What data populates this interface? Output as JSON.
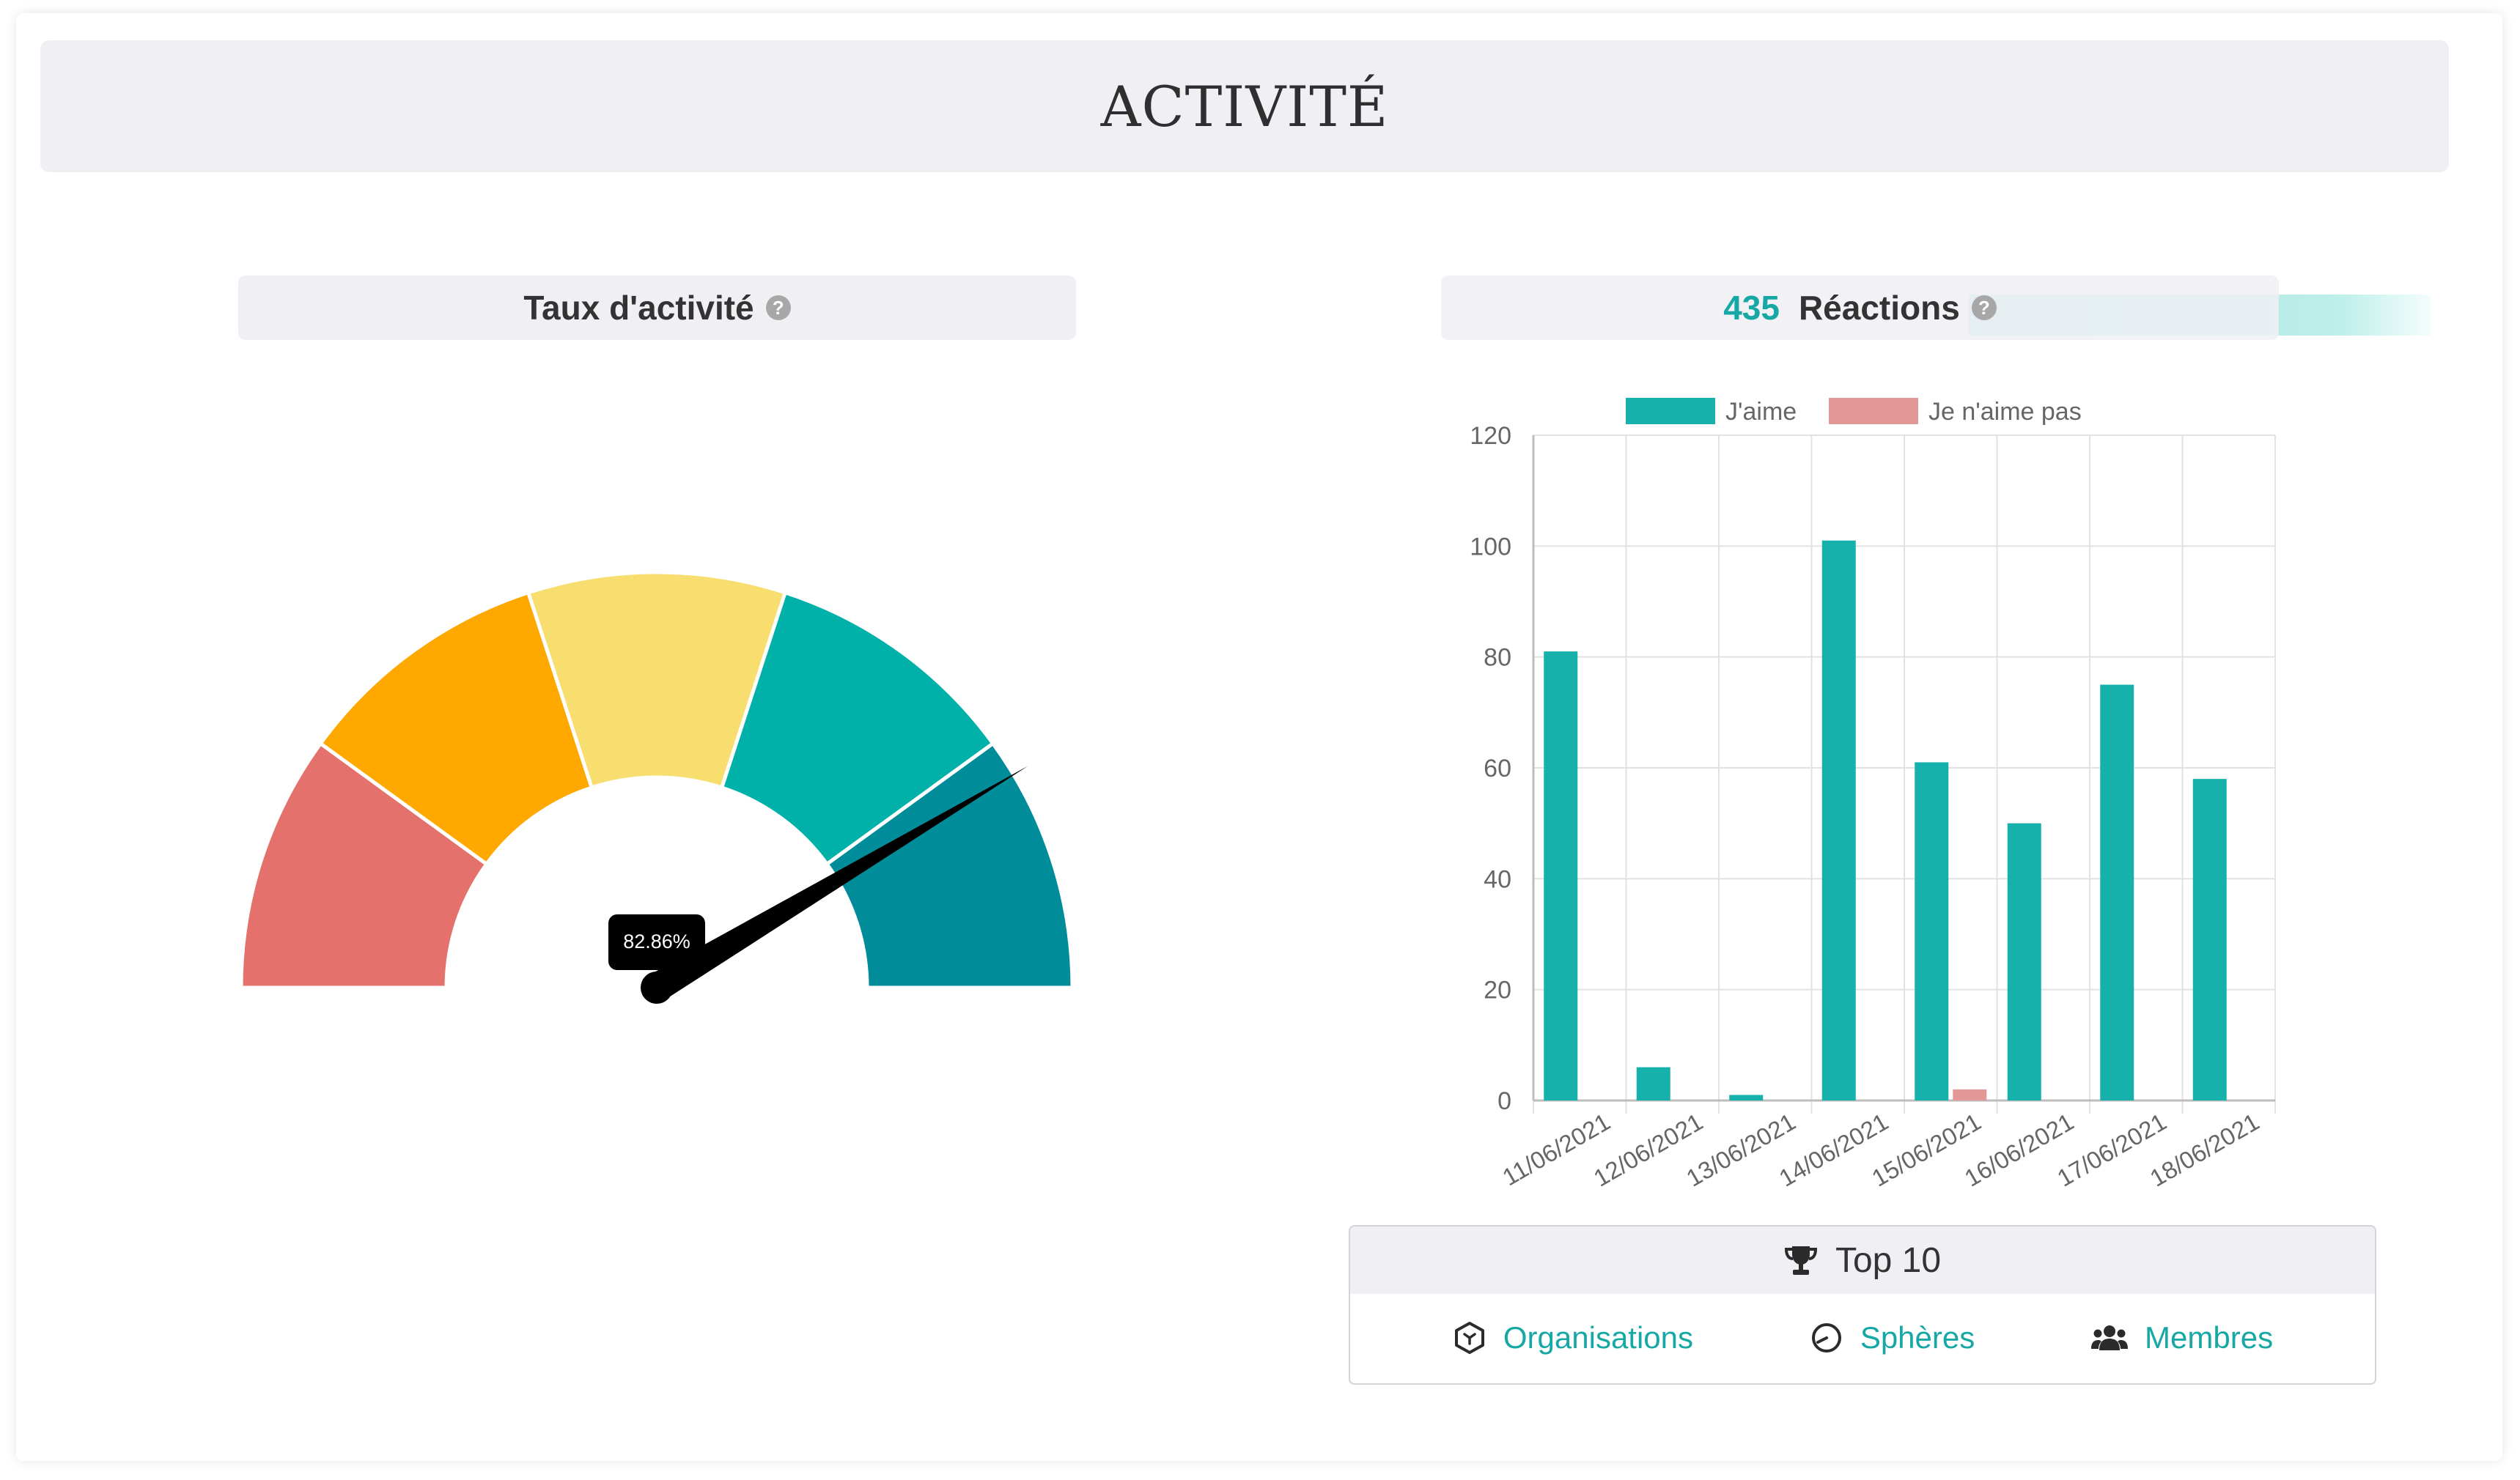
{
  "page": {
    "title": "ACTIVITÉ"
  },
  "activity_rate": {
    "title": "Taux d'activité",
    "help_icon": "question-circle-icon",
    "value": 82.86,
    "value_label": "82.86%",
    "zones": [
      {
        "color": "#e4716b"
      },
      {
        "color": "#fea800"
      },
      {
        "color": "#f8de6e"
      },
      {
        "color": "#00b1a9"
      },
      {
        "color": "#008d99"
      }
    ]
  },
  "reactions": {
    "count": "435",
    "title": "Réactions",
    "help_icon": "question-circle-icon"
  },
  "chart_data": {
    "type": "bar",
    "categories": [
      "11/06/2021",
      "12/06/2021",
      "13/06/2021",
      "14/06/2021",
      "15/06/2021",
      "16/06/2021",
      "17/06/2021",
      "18/06/2021"
    ],
    "series": [
      {
        "name": "J'aime",
        "color": "#17b1ab",
        "values": [
          81,
          6,
          1,
          101,
          61,
          50,
          75,
          58
        ]
      },
      {
        "name": "Je n'aime pas",
        "color": "#e39898",
        "values": [
          0,
          0,
          0,
          0,
          2,
          0,
          0,
          0
        ]
      }
    ],
    "ylim": [
      0,
      120
    ],
    "yticks": [
      0,
      20,
      40,
      60,
      80,
      100,
      120
    ],
    "grid": true,
    "legend": "top"
  },
  "top10": {
    "title": "Top 10",
    "icon": "trophy-icon",
    "links": [
      {
        "label": "Organisations",
        "icon": "cube-icon"
      },
      {
        "label": "Sphères",
        "icon": "pie-icon"
      },
      {
        "label": "Membres",
        "icon": "users-icon"
      }
    ]
  }
}
